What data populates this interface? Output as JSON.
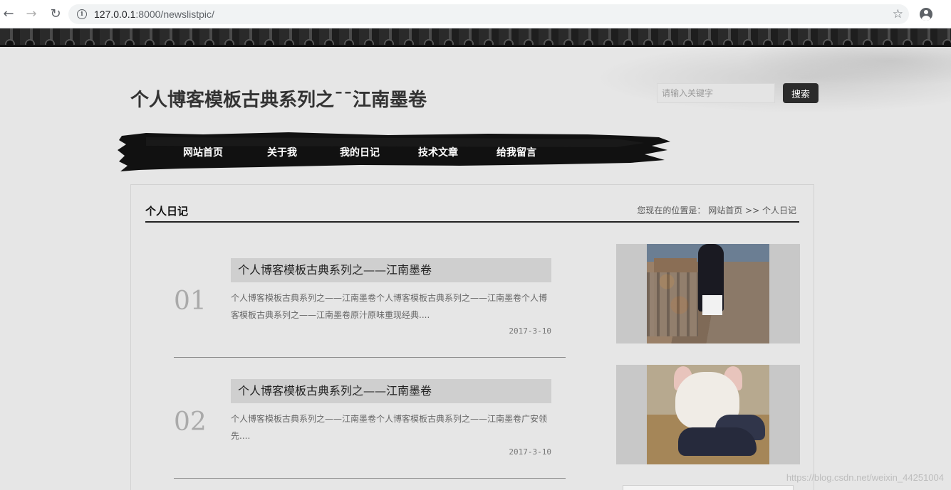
{
  "browser": {
    "url_host": "127.0.0.1",
    "url_port_path": ":8000/newslistpic/"
  },
  "site": {
    "title": "个人博客模板古典系列之¯¯江南墨卷",
    "search_placeholder": "请输入关键字",
    "search_button": "搜索"
  },
  "nav": {
    "items": [
      "网站首页",
      "关于我",
      "我的日记",
      "技术文章",
      "给我留言"
    ]
  },
  "section": {
    "title": "个人日记",
    "breadcrumb_prefix": "您现在的位置是：",
    "breadcrumb_home": "网站首页",
    "breadcrumb_sep": " >> ",
    "breadcrumb_current": "个人日记"
  },
  "articles": [
    {
      "num": "01",
      "title": "个人博客模板古典系列之——江南墨卷",
      "desc": "个人博客模板古典系列之——江南墨卷个人博客模板古典系列之——江南墨卷个人博客模板古典系列之——江南墨卷原汁原味重现经典....",
      "date": "2017-3-10"
    },
    {
      "num": "02",
      "title": "个人博客模板古典系列之——江南墨卷",
      "desc": "个人博客模板古典系列之——江南墨卷个人博客模板古典系列之——江南墨卷广安领先....",
      "date": "2017-3-10"
    }
  ],
  "watermark": "https://blog.csdn.net/weixin_44251004",
  "colors": {
    "nav_brush": "#111111",
    "search_button_bg": "#2b2b2b",
    "title_text": "#333333"
  }
}
